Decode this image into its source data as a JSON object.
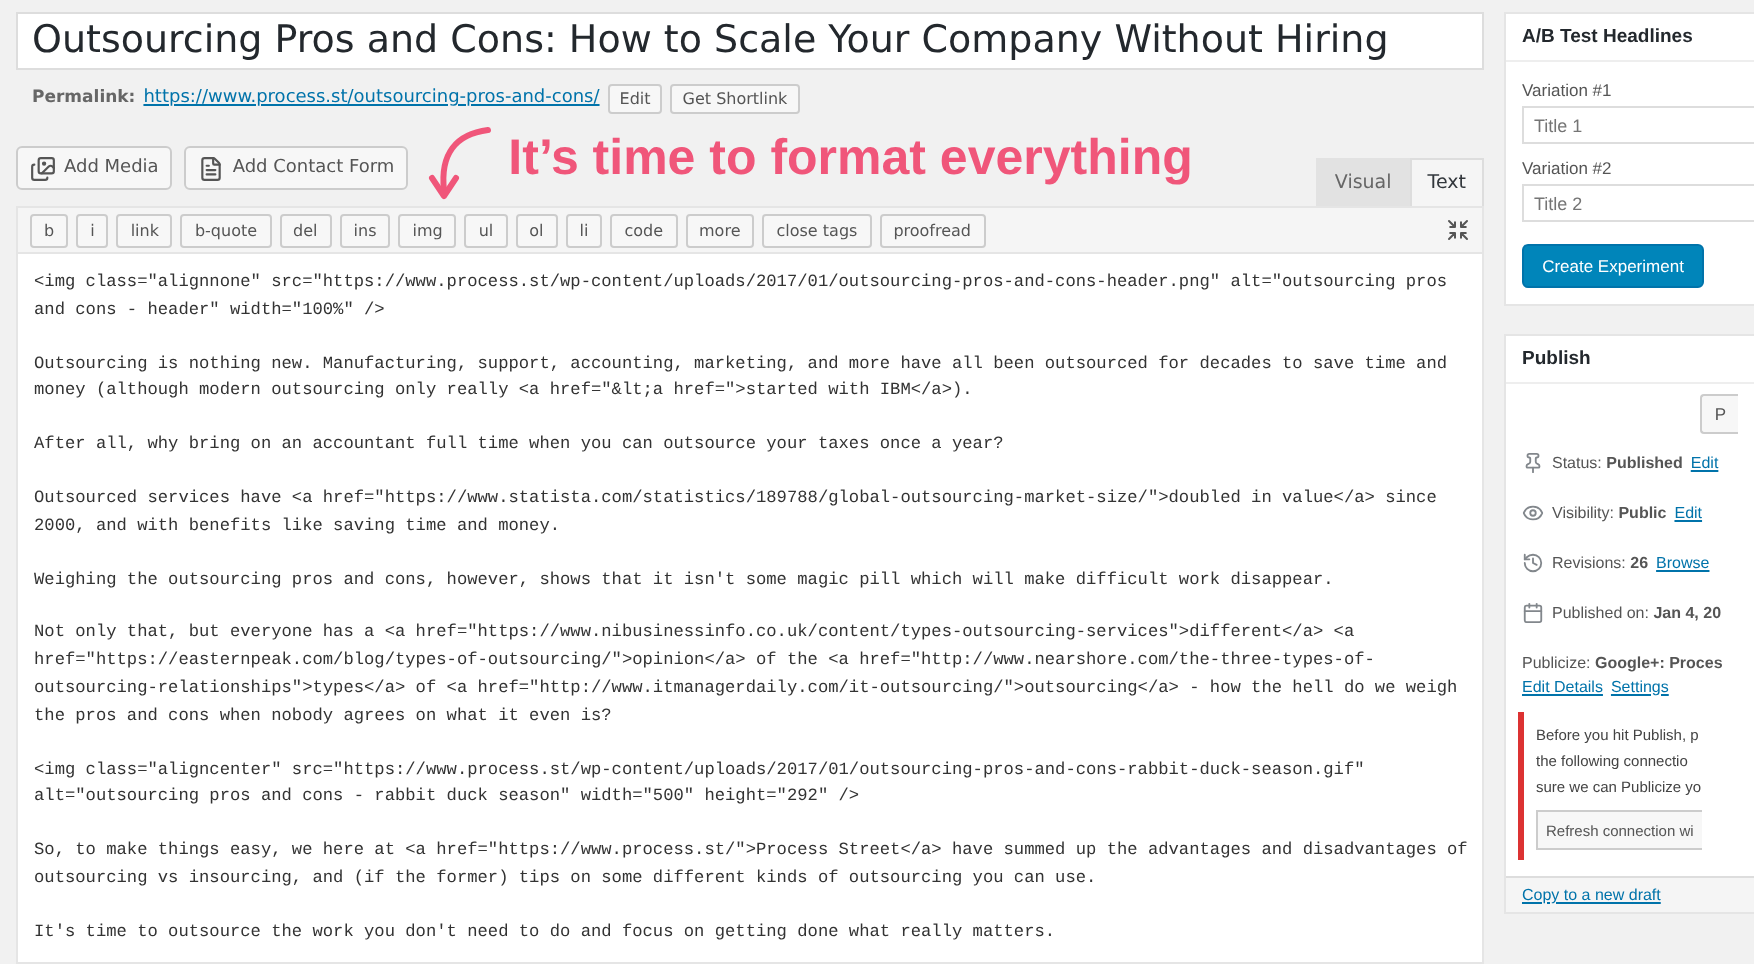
{
  "title": "Outsourcing Pros and Cons: How to Scale Your Company Without Hiring",
  "permalink": {
    "label": "Permalink:",
    "url": "https://www.process.st/outsourcing-pros-and-cons/",
    "buttons": [
      "Edit",
      "Get Shortlink"
    ]
  },
  "media_buttons": [
    {
      "kind": "media",
      "label": "Add Media"
    },
    {
      "kind": "form",
      "label": "Add Contact Form"
    }
  ],
  "annotation": "It’s time to format everything",
  "editor_tabs": [
    {
      "label": "Visual",
      "selected": false
    },
    {
      "label": "Text",
      "selected": true
    }
  ],
  "quicktags": [
    "b",
    "i",
    "link",
    "b-quote",
    "del",
    "ins",
    "img",
    "ul",
    "ol",
    "li",
    "code",
    "more",
    "close tags",
    "proofread"
  ],
  "editor_paragraphs": [
    "<img class=\"alignnone\" src=\"https://www.process.st/wp-content/uploads/2017/01/outsourcing-pros-and-cons-header.png\" alt=\"outsourcing pros\nand cons - header\" width=\"100%\" />",
    "Outsourcing is nothing new. Manufacturing, support, accounting, marketing, and more have all been outsourced for decades to save time and\nmoney (although modern outsourcing only really <a href=\"&lt;a href=\">started with IBM</a>).",
    "After all, why bring on an accountant full time when you can outsource your taxes once a year?",
    "Outsourced services have <a href=\"https://www.statista.com/statistics/189788/global-outsourcing-market-size/\">doubled in value</a> since\n2000, and with benefits like saving time and money.",
    "Weighing the outsourcing pros and cons, however, shows that it isn't some magic pill which will make difficult work disappear.",
    "Not only that, but everyone has a <a href=\"https://www.nibusinessinfo.co.uk/content/types-outsourcing-services\">different</a> <a\nhref=\"https://easternpeak.com/blog/types-of-outsourcing/\">opinion</a> of the <a href=\"http://www.nearshore.com/the-three-types-of-\noutsourcing-relationships\">types</a> of <a href=\"http://www.itmanagerdaily.com/it-outsourcing/\">outsourcing</a> - how the hell do we weigh\nthe pros and cons when nobody agrees on what it even is?",
    "<img class=\"aligncenter\" src=\"https://www.process.st/wp-content/uploads/2017/01/outsourcing-pros-and-cons-rabbit-duck-season.gif\"\nalt=\"outsourcing pros and cons - rabbit duck season\" width=\"500\" height=\"292\" />",
    "So, to make things easy, we here at <a href=\"https://www.process.st/\">Process Street</a> have summed up the advantages and disadvantages of\noutsourcing vs insourcing, and (if the former) tips on some different kinds of outsourcing you can use.",
    "It's time to outsource the work you don't need to do and focus on getting done what really matters."
  ],
  "ab_test": {
    "title": "A/B Test Headlines",
    "variations": [
      {
        "label": "Variation #1",
        "placeholder": "Title 1"
      },
      {
        "label": "Variation #2",
        "placeholder": "Title 2"
      }
    ],
    "button": "Create Experiment"
  },
  "publish": {
    "title": "Publish",
    "preview_button": "P",
    "meta": [
      {
        "kind": "status",
        "label": "Status:",
        "value": "Published",
        "link": "Edit"
      },
      {
        "kind": "visibility",
        "label": "Visibility:",
        "value": "Public",
        "link": "Edit"
      },
      {
        "kind": "revisions",
        "label": "Revisions:",
        "value": "26",
        "link": "Browse"
      },
      {
        "kind": "date",
        "label": "Published on:",
        "value": "Jan 4, 20"
      }
    ],
    "publicize": {
      "label": "Publicize:",
      "value": "Google+: Proces",
      "links": [
        "Edit Details",
        "Settings"
      ]
    },
    "notice": "Before you hit Publish, p\nthe following connectio\nsure we can Publicize yo",
    "refresh_button": "Refresh connection wi",
    "copy_link": "Copy to a new draft"
  }
}
